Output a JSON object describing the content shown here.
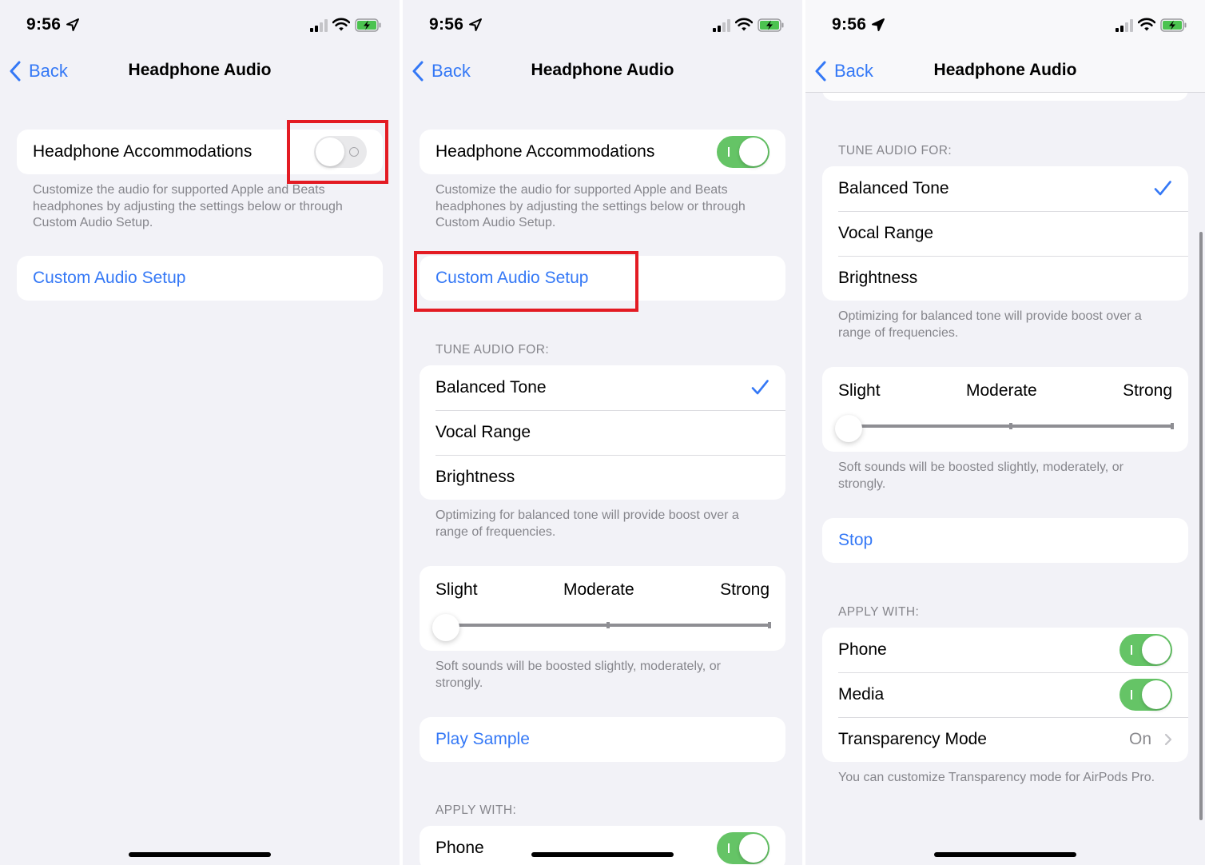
{
  "status_bar": {
    "time": "9:56",
    "icons": [
      "location-arrow-icon",
      "cellular-signal-icon",
      "wifi-icon",
      "battery-charging-icon"
    ]
  },
  "nav": {
    "back_label": "Back",
    "title": "Headphone Audio"
  },
  "colors": {
    "accent": "#3478f6",
    "toggle_on": "#65c466",
    "toggle_off": "#e9e9eb",
    "background": "#f2f2f7",
    "highlight_box": "#e31b23",
    "secondary_text": "#85858b"
  },
  "panels": [
    {
      "headphone_accommodations": {
        "label": "Headphone Accommodations",
        "enabled": false
      },
      "description": "Customize the audio for supported Apple and Beats headphones by adjusting the settings below or through Custom Audio Setup.",
      "custom_audio_setup_label": "Custom Audio Setup",
      "highlight": "headphone-accommodations-toggle"
    },
    {
      "headphone_accommodations": {
        "label": "Headphone Accommodations",
        "enabled": true
      },
      "description": "Customize the audio for supported Apple and Beats headphones by adjusting the settings below or through Custom Audio Setup.",
      "custom_audio_setup_label": "Custom Audio Setup",
      "highlight": "custom-audio-setup-button",
      "tune_audio": {
        "header": "TUNE AUDIO FOR:",
        "options": [
          "Balanced Tone",
          "Vocal Range",
          "Brightness"
        ],
        "selected": "Balanced Tone",
        "footer": "Optimizing for balanced tone will provide boost over a range of frequencies."
      },
      "boost_slider": {
        "labels": [
          "Slight",
          "Moderate",
          "Strong"
        ],
        "value": "Slight",
        "value_fraction": 0,
        "footer": "Soft sounds will be boosted slightly, moderately, or strongly."
      },
      "sample_button_label": "Play Sample",
      "apply_with": {
        "header": "APPLY WITH:",
        "items": [
          {
            "label": "Phone",
            "enabled": true
          }
        ]
      }
    },
    {
      "tune_audio": {
        "header": "TUNE AUDIO FOR:",
        "options": [
          "Balanced Tone",
          "Vocal Range",
          "Brightness"
        ],
        "selected": "Balanced Tone",
        "footer": "Optimizing for balanced tone will provide boost over a range of frequencies."
      },
      "boost_slider": {
        "labels": [
          "Slight",
          "Moderate",
          "Strong"
        ],
        "value": "Slight",
        "value_fraction": 0,
        "footer": "Soft sounds will be boosted slightly, moderately, or strongly."
      },
      "sample_button_label": "Stop",
      "apply_with": {
        "header": "APPLY WITH:",
        "items": [
          {
            "label": "Phone",
            "enabled": true
          },
          {
            "label": "Media",
            "enabled": true
          }
        ],
        "transparency_mode": {
          "label": "Transparency Mode",
          "value": "On"
        },
        "footer": "You can customize Transparency mode for AirPods Pro."
      }
    }
  ]
}
